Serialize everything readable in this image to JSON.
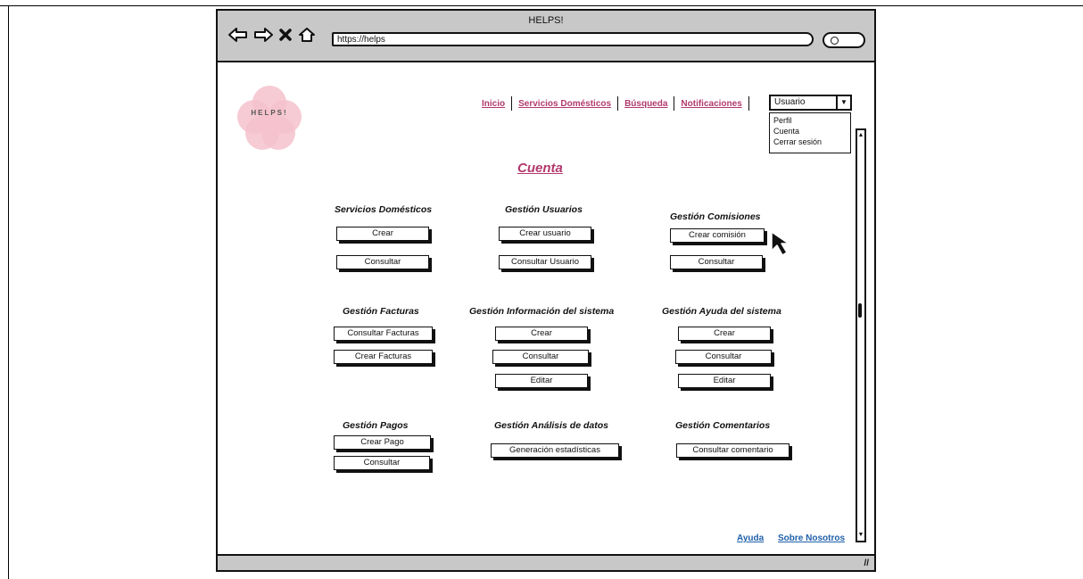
{
  "window": {
    "title": "HELPS!",
    "url": "https://helps"
  },
  "logo": {
    "text": "HELPS!"
  },
  "nav": {
    "items": [
      "Inicio",
      "Servicios Domésticos",
      "Búsqueda",
      "Notificaciones"
    ]
  },
  "user_menu": {
    "selected": "Usuario",
    "options": [
      "Perfil",
      "Cuenta",
      "Cerrar sesión"
    ]
  },
  "page": {
    "title": "Cuenta"
  },
  "sections": {
    "servicios": {
      "title": "Servicios Domésticos",
      "buttons": [
        "Crear",
        "Consultar"
      ]
    },
    "usuarios": {
      "title": "Gestión Usuarios",
      "buttons": [
        "Crear usuario",
        "Consultar Usuario"
      ]
    },
    "comisiones": {
      "title": "Gestión Comisiones",
      "buttons": [
        "Crear comisión",
        "Consultar"
      ]
    },
    "facturas": {
      "title": "Gestión Facturas",
      "buttons": [
        "Consultar Facturas",
        "Crear Facturas"
      ]
    },
    "informacion": {
      "title": "Gestión Información del sistema",
      "buttons": [
        "Crear",
        "Consultar",
        "Editar"
      ]
    },
    "ayuda": {
      "title": "Gestión Ayuda del sistema",
      "buttons": [
        "Crear",
        "Consultar",
        "Editar"
      ]
    },
    "pagos": {
      "title": "Gestión Pagos",
      "buttons": [
        "Crear Pago",
        "Consultar"
      ]
    },
    "analisis": {
      "title": "Gestión Análisis de datos",
      "buttons": [
        "Generación estadísticas"
      ]
    },
    "comentarios": {
      "title": "Gestión Comentarios",
      "buttons": [
        "Consultar comentario"
      ]
    }
  },
  "footer": {
    "help": "Ayuda",
    "about": "Sobre Nosotros"
  },
  "colors": {
    "accent": "#b23a6e",
    "link": "#1f5fa8",
    "chrome": "#c8c8c8",
    "logo": "#f4c2cc"
  }
}
